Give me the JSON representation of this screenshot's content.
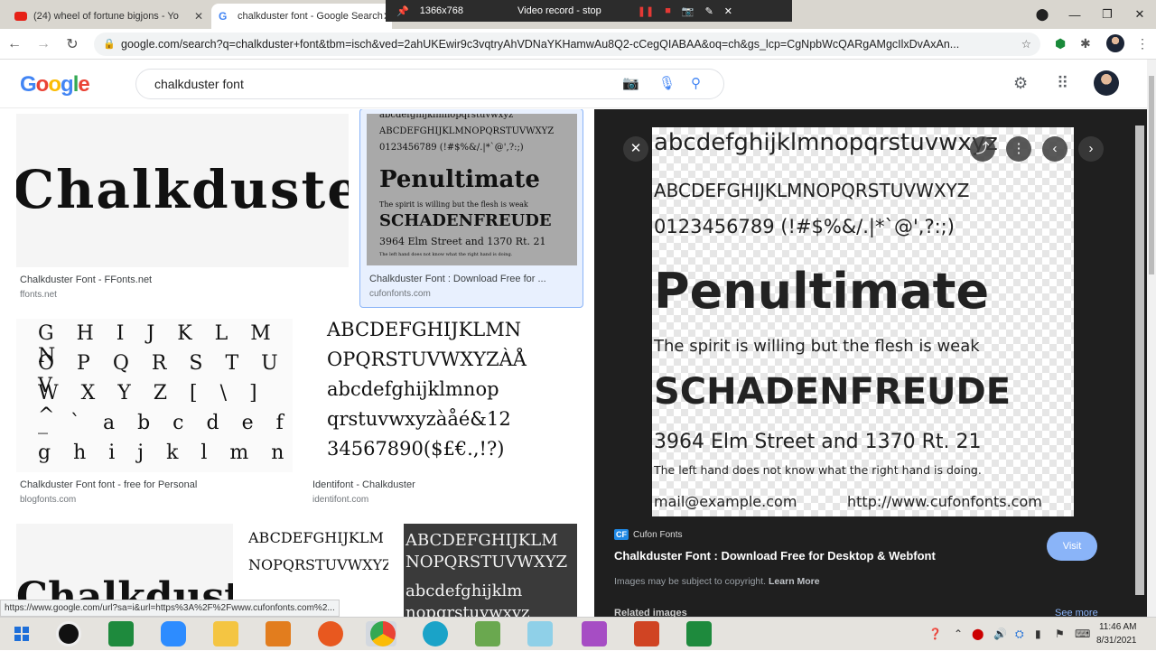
{
  "browser": {
    "tabs": [
      {
        "title": "(24) wheel of fortune bigjons - Yo",
        "close": "✕"
      },
      {
        "title": "chalkduster font - Google Search",
        "close": "✕"
      }
    ],
    "url": "google.com/search?q=chalkduster+font&tbm=isch&ved=2ahUKEwir9c3vqtryAhVDNaYKHamwAu8Q2-cCegQIABAA&oq=ch&gs_lcp=CgNpbWcQARgAMgcIlxDvAxAn..."
  },
  "recorder": {
    "resolution": "1366x768",
    "status": "Video record - stop"
  },
  "google": {
    "logo": "Google",
    "query": "chalkduster font"
  },
  "results": [
    {
      "title": "Chalkduster Font - FFonts.net",
      "site": "ffonts.net",
      "sample": "Chalkduster"
    },
    {
      "title": "Chalkduster Font : Download Free for ...",
      "site": "cufonfonts.com",
      "lines": [
        "abcdefghijklmnopqrstuvwxyz",
        "ABCDEFGHIJKLMNOPQRSTUVWXYZ",
        "0123456789 (!#$%&/.|*`@',?:;)",
        "Penultimate",
        "The spirit is willing but the flesh is weak",
        "SCHADENFREUDE",
        "3964 Elm Street and 1370 Rt. 21",
        "The left hand does not know what the right hand is doing."
      ]
    },
    {
      "title": "Chalkduster Font font - free for Personal",
      "site": "blogfonts.com",
      "rows": [
        "G H I J K L M N",
        "O P Q R S T U V",
        "W X Y Z [ \\ ] ^",
        "_ ` a b c d e f",
        "g h i j k l m n"
      ]
    },
    {
      "title": "Identifont - Chalkduster",
      "site": "identifont.com",
      "lines": [
        "ABCDEFGHIJKLMN",
        "OPQRSTUVWXYZÀÅ",
        "abcdefghijklmnop",
        "qrstuvwxyzàåé&12",
        "34567890($£€.,!?)"
      ]
    },
    {
      "sample": "Chalkduster"
    },
    {
      "lines": [
        "ABCDEFGHIJKLM",
        "NOPQRSTUVWXYZ"
      ]
    },
    {
      "lines": [
        "ABCDEFGHIJKLM",
        "NOPQRSTUVWXYZ",
        "abcdefghijklm",
        "nopqrstuvwxyz"
      ]
    }
  ],
  "preview": {
    "lines": [
      "abcdefghijklmnopqrstuvwxyz",
      "ABCDEFGHIJKLMNOPQRSTUVWXYZ",
      "0123456789 (!#$%&/.|*`@',?:;)",
      "Penultimate",
      "The spirit is willing but the flesh is weak",
      "SCHADENFREUDE",
      "3964 Elm Street and 1370 Rt. 21",
      "The left hand does not know what the right hand is doing.",
      "mail@example.com",
      "http://www.cufonfonts.com"
    ],
    "source_badge": "CF",
    "source": "Cufon Fonts",
    "title": "Chalkduster Font : Download Free for Desktop & Webfont",
    "visit": "Visit",
    "copyright": "Images may be subject to copyright.",
    "learn_more": "Learn More",
    "related": "Related images",
    "see_more": "See more"
  },
  "status_url": "https://www.google.com/url?sa=i&url=https%3A%2F%2Fwww.cufonfonts.com%2...",
  "clock": {
    "time": "11:46 AM",
    "date": "8/31/2021"
  },
  "colors": {
    "accent": "#8ab4f8",
    "panel": "#1f1f1f",
    "taskbar": "#e5e3de"
  }
}
